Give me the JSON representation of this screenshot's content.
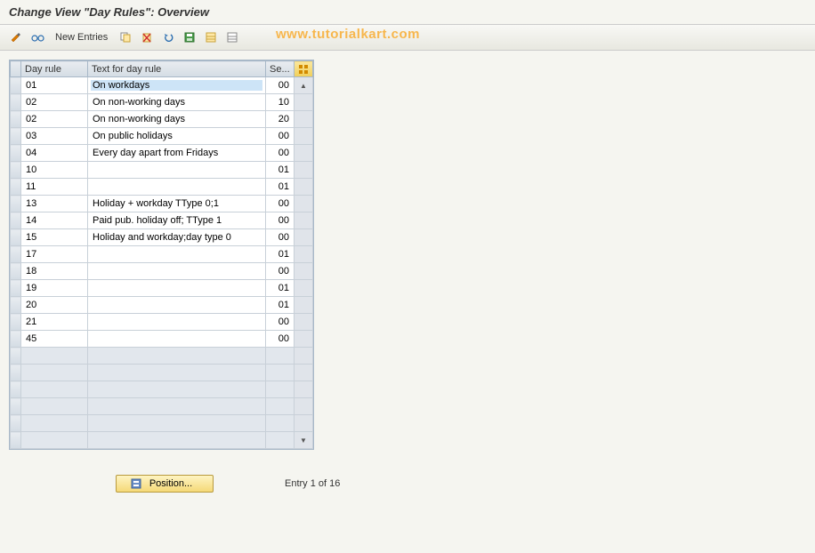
{
  "title": "Change View \"Day Rules\": Overview",
  "watermark": "www.tutorialkart.com",
  "toolbar": {
    "new_entries": "New Entries"
  },
  "columns": {
    "day_rule": "Day rule",
    "text": "Text for day rule",
    "se": "Se..."
  },
  "rows": [
    {
      "day": "01",
      "text": "On workdays",
      "se": "00",
      "selected": true
    },
    {
      "day": "02",
      "text": "On non-working days",
      "se": "10"
    },
    {
      "day": "02",
      "text": "On non-working days",
      "se": "20"
    },
    {
      "day": "03",
      "text": "On public holidays",
      "se": "00"
    },
    {
      "day": "04",
      "text": "Every day apart from Fridays",
      "se": "00"
    },
    {
      "day": "10",
      "text": "",
      "se": "01"
    },
    {
      "day": "11",
      "text": "",
      "se": "01"
    },
    {
      "day": "13",
      "text": "Holiday + workday TType 0;1",
      "se": "00"
    },
    {
      "day": "14",
      "text": "Paid pub. holiday off; TType 1",
      "se": "00"
    },
    {
      "day": "15",
      "text": "Holiday and workday;day type 0",
      "se": "00"
    },
    {
      "day": "17",
      "text": "",
      "se": "01"
    },
    {
      "day": "18",
      "text": "",
      "se": "00"
    },
    {
      "day": "19",
      "text": "",
      "se": "01"
    },
    {
      "day": "20",
      "text": "",
      "se": "01"
    },
    {
      "day": "21",
      "text": "",
      "se": "00"
    },
    {
      "day": "45",
      "text": "",
      "se": "00"
    }
  ],
  "empty_rows": 6,
  "footer": {
    "position_label": "Position...",
    "entry_text": "Entry 1 of 16"
  }
}
